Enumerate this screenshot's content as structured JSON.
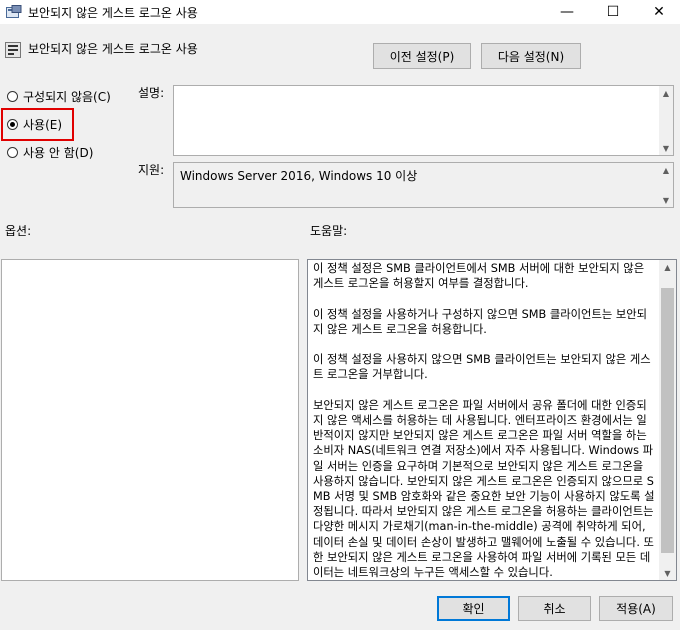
{
  "window": {
    "title": "보안되지 않은 게스트 로그온 사용",
    "minimize": "—",
    "maximize": "☐",
    "close": "✕"
  },
  "header": {
    "policy_name": "보안되지 않은 게스트 로그온 사용",
    "prev_button": "이전 설정(P)",
    "next_button": "다음 설정(N)"
  },
  "state_options": [
    {
      "label": "구성되지 않음(C)",
      "selected": false
    },
    {
      "label": "사용(E)",
      "selected": true
    },
    {
      "label": "사용 안 함(D)",
      "selected": false
    }
  ],
  "comment": {
    "label": "설명:",
    "value": ""
  },
  "supported_on": {
    "label": "지원:",
    "value": "Windows Server 2016, Windows 10 이상"
  },
  "options_label": "옵션:",
  "help_label": "도움말:",
  "help_text": "이 정책 설정은 SMB 클라이언트에서 SMB 서버에 대한 보안되지 않은 게스트 로그온을 허용할지 여부를 결정합니다.\n\n이 정책 설정을 사용하거나 구성하지 않으면 SMB 클라이언트는 보안되지 않은 게스트 로그온을 허용합니다.\n\n이 정책 설정을 사용하지 않으면 SMB 클라이언트는 보안되지 않은 게스트 로그온을 거부합니다.\n\n보안되지 않은 게스트 로그온은 파일 서버에서 공유 폴더에 대한 인증되지 않은 액세스를 허용하는 데 사용됩니다. 엔터프라이즈 환경에서는 일반적이지 않지만 보안되지 않은 게스트 로그온은 파일 서버 역할을 하는 소비자 NAS(네트워크 연결 저장소)에서 자주 사용됩니다. Windows 파일 서버는 인증을 요구하며 기본적으로 보안되지 않은 게스트 로그온을 사용하지 않습니다. 보안되지 않은 게스트 로그온은 인증되지 않으므로 SMB 서명 및 SMB 암호화와 같은 중요한 보안 기능이 사용하지 않도록 설정됩니다. 따라서 보안되지 않은 게스트 로그온을 허용하는 클라이언트는 다양한 메시지 가로채기(man-in-the-middle) 공격에 취약하게 되어, 데이터 손실 및 데이터 손상이 발생하고 맬웨어에 노출될 수 있습니다. 또한 보안되지 않은 게스트 로그온을 사용하여 파일 서버에 기록된 모든 데이터는 네트워크상의 누구든 액세스할 수 있습니다.",
  "footer": {
    "ok": "확인",
    "cancel": "취소",
    "apply": "적용(A)"
  },
  "icons": {
    "chevron_up": "▲",
    "chevron_down": "▼"
  },
  "colors": {
    "highlight_border": "#e00000",
    "accent": "#0078d7"
  }
}
